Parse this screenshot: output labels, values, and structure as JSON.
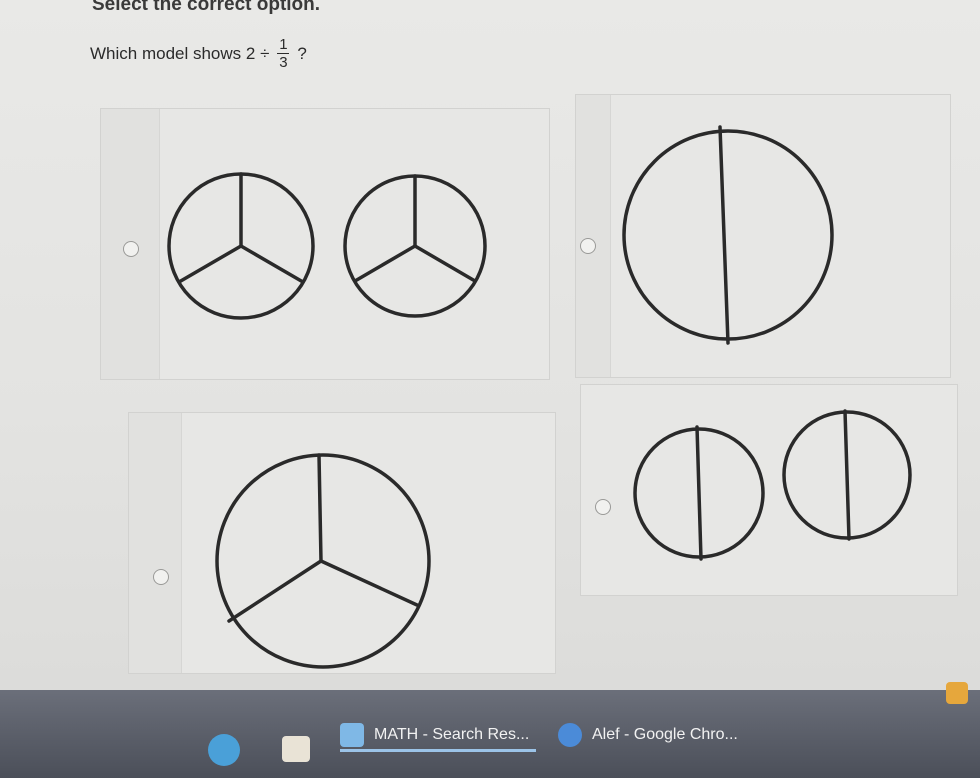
{
  "instruction": "Select the correct option.",
  "question": {
    "text": "Which model shows 2 ÷",
    "fraction_numerator": "1",
    "fraction_denominator": "3",
    "suffix": "?"
  },
  "options": [
    {
      "id": "A",
      "model": "two-circles-thirds"
    },
    {
      "id": "B",
      "model": "one-circle-halves"
    },
    {
      "id": "C",
      "model": "one-circle-thirds"
    },
    {
      "id": "D",
      "model": "two-circles-halves"
    }
  ],
  "taskbar": {
    "items": [
      {
        "label": "MATH - Search Res..."
      },
      {
        "label": "Alef - Google Chro..."
      }
    ]
  },
  "colors": {
    "stroke": "#2a2a2a",
    "card_bg": "#e7e7e5",
    "taskbar": "#555963",
    "active_underline": "#9cc4e8"
  }
}
